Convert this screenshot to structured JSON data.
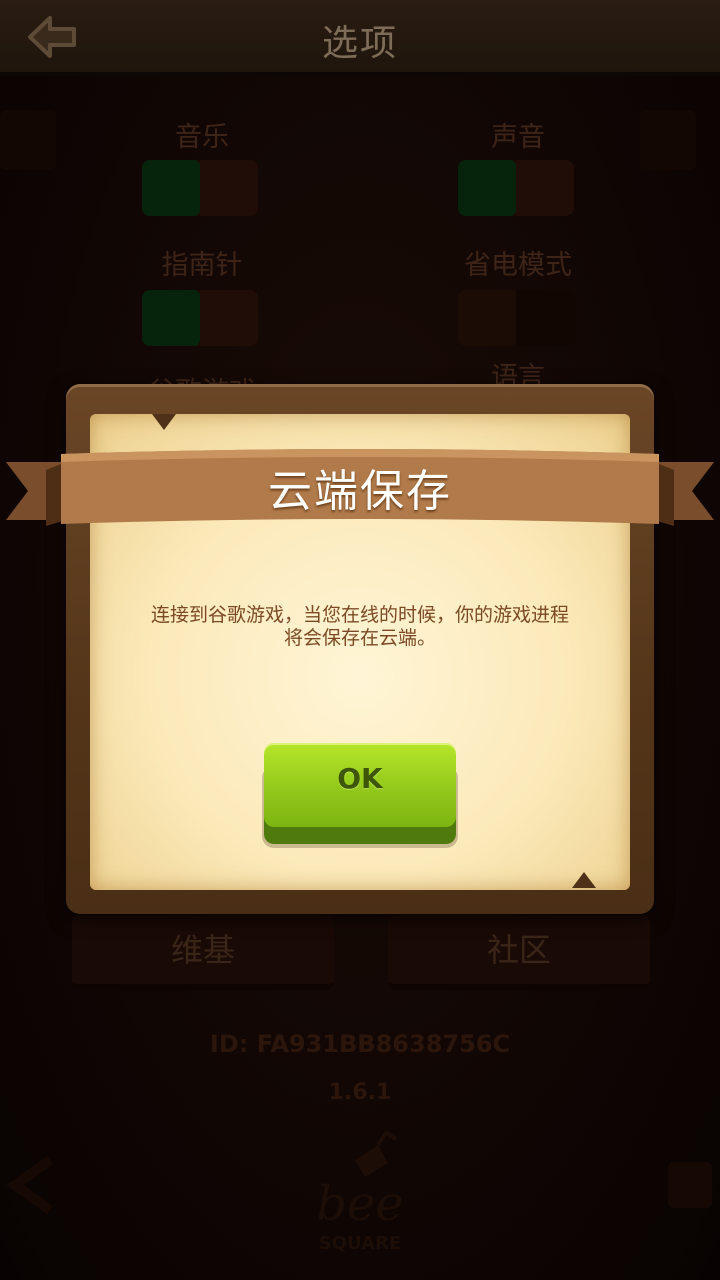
{
  "header": {
    "title": "选项"
  },
  "settings": {
    "music": {
      "label": "音乐",
      "enabled": true
    },
    "sound": {
      "label": "声音",
      "enabled": true
    },
    "compass": {
      "label": "指南针",
      "enabled": true
    },
    "power_saving": {
      "label": "省电模式",
      "enabled": false
    },
    "language_label": "语言",
    "google_games_label": "谷歌游戏"
  },
  "bottom_buttons": {
    "wiki": "维基",
    "community": "社区"
  },
  "device_id": "ID: FA931BB8638756C",
  "version": "1.6.1",
  "logo": {
    "text_top": "bee",
    "text_bottom": "SQUARE"
  },
  "dialog": {
    "title": "云端保存",
    "message_line1": "连接到谷歌游戏，当您在线的时候，你的游戏进程",
    "message_line2": "将会保存在云端。",
    "ok_label": "OK"
  },
  "colors": {
    "ok_button": "#8fc61a",
    "ribbon": "#b07a4a",
    "paper": "#fbe9b9",
    "frame": "#5a3a1d"
  }
}
